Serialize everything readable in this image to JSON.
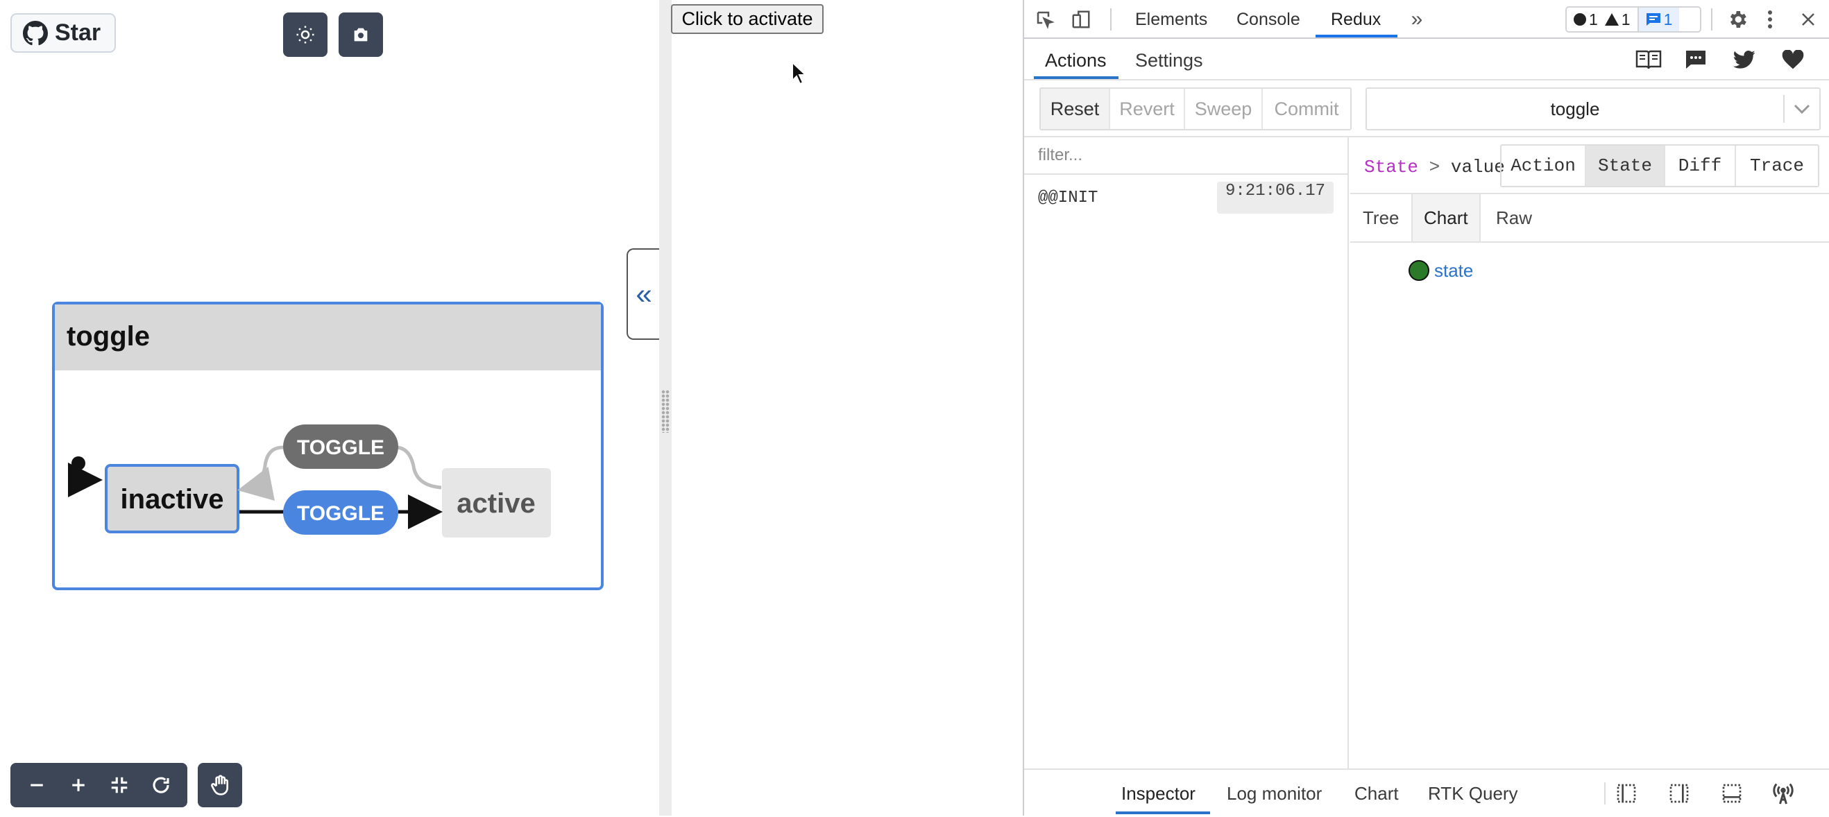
{
  "viz": {
    "star_label": "Star",
    "machine_id": "toggle",
    "states": {
      "inactive": "inactive",
      "active": "active"
    },
    "events": {
      "upper": "TOGGLE",
      "lower": "TOGGLE"
    },
    "colors": {
      "accent": "#4a86e0",
      "event_inactive": "#6e6e6e",
      "dark_button": "#3d4656"
    }
  },
  "app": {
    "activate_button": "Click to activate"
  },
  "devtools": {
    "tabs": [
      "Elements",
      "Console",
      "Redux"
    ],
    "more_tabs_icon": "chevron-double-right-icon",
    "counts": {
      "errors": "1",
      "warnings": "1",
      "messages": "1"
    },
    "redux": {
      "top_tabs": {
        "actions": "Actions",
        "settings": "Settings"
      },
      "buttons": {
        "reset": "Reset",
        "revert": "Revert",
        "sweep": "Sweep",
        "commit": "Commit"
      },
      "instance": "toggle",
      "filter_placeholder": "filter...",
      "actions": [
        {
          "name": "@@INIT",
          "time": "9:21:06.17"
        }
      ],
      "breadcrumb": {
        "root": "State",
        "sep": ">",
        "leaf": "value"
      },
      "inspector_tabs": {
        "action": "Action",
        "state": "State",
        "diff": "Diff",
        "trace": "Trace"
      },
      "view_tabs": {
        "tree": "Tree",
        "chart": "Chart",
        "raw": "Raw"
      },
      "chart_node": "state",
      "bottom_tabs": {
        "inspector": "Inspector",
        "log_monitor": "Log monitor",
        "chart": "Chart",
        "rtk_query": "RTK Query"
      }
    }
  }
}
